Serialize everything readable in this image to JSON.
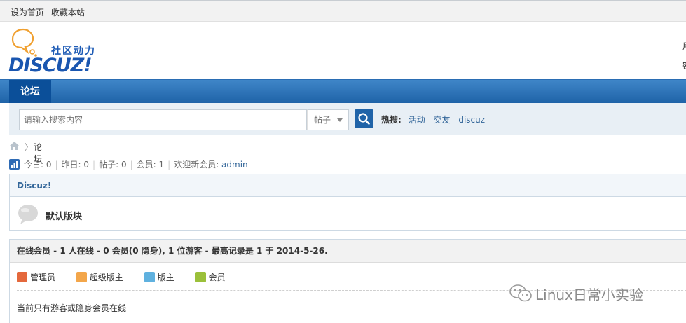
{
  "topbar": {
    "set_home": "设为首页",
    "bookmark": "收藏本站"
  },
  "header": {
    "logo_cn": "社区动力",
    "logo_en": "DISCUZ!",
    "right_char_1": "用",
    "right_char_2": "密"
  },
  "nav": {
    "active_tab": "论坛"
  },
  "search": {
    "placeholder": "请输入搜索内容",
    "type_selected": "帖子",
    "hot_label": "热搜:",
    "hot_keywords": [
      "活动",
      "交友",
      "discuz"
    ]
  },
  "breadcrumb": {
    "separator": "〉",
    "current": "论坛"
  },
  "stats": {
    "today": "今日: 0",
    "yesterday": "昨日: 0",
    "posts": "帖子: 0",
    "members": "会员: 1",
    "welcome_prefix": "欢迎新会员: ",
    "newest_member": "admin"
  },
  "forum": {
    "category": "Discuz!",
    "board_name": "默认版块"
  },
  "online": {
    "header": "在线会员 - 1 人在线 - 0 会员(0 隐身), 1 位游客 - 最高记录是 1 于 2014-5-26.",
    "legend": [
      {
        "label": "管理员",
        "color": "#e4683c"
      },
      {
        "label": "超级版主",
        "color": "#f3a64a"
      },
      {
        "label": "版主",
        "color": "#5fb1df"
      },
      {
        "label": "会员",
        "color": "#9bc03a"
      }
    ],
    "only_guests": "当前只有游客或隐身会员在线"
  },
  "watermark": {
    "text": "Linux日常小实验"
  },
  "colors": {
    "nav_blue": "#1f63a8",
    "link": "#336699",
    "logo_orange": "#f0a030"
  }
}
